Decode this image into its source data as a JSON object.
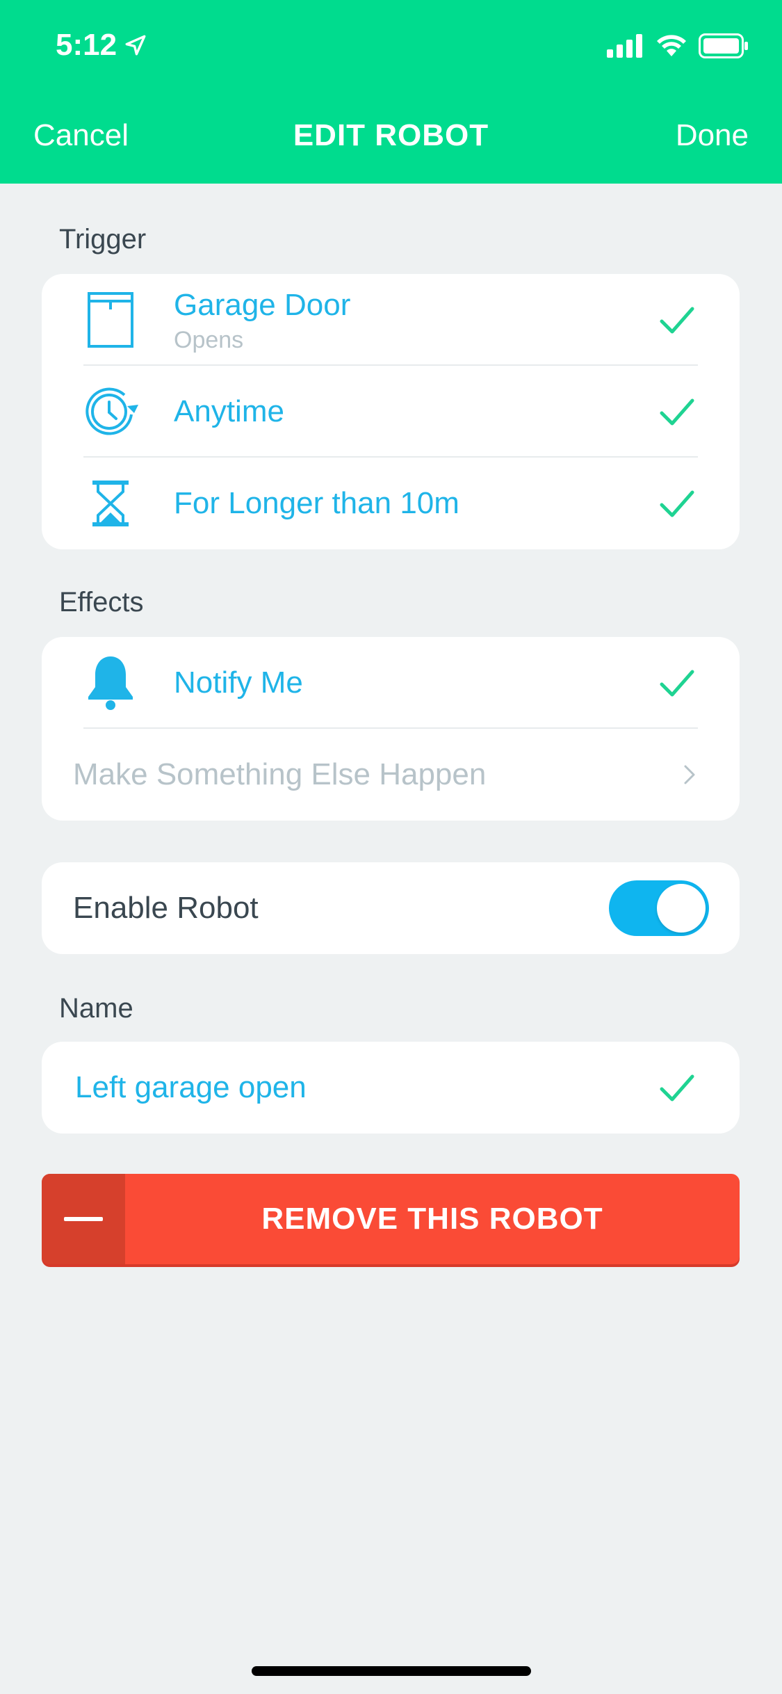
{
  "status_bar": {
    "time": "5:12"
  },
  "nav": {
    "cancel_label": "Cancel",
    "title": "EDIT ROBOT",
    "done_label": "Done"
  },
  "trigger": {
    "section_label": "Trigger",
    "items": [
      {
        "label": "Garage Door",
        "sublabel": "Opens",
        "icon": "garage-door-icon",
        "checked": true
      },
      {
        "label": "Anytime",
        "icon": "clock-icon",
        "checked": true
      },
      {
        "label": "For Longer than 10m",
        "icon": "hourglass-icon",
        "checked": true
      }
    ]
  },
  "effects": {
    "section_label": "Effects",
    "items": [
      {
        "label": "Notify Me",
        "icon": "bell-icon",
        "checked": true
      }
    ],
    "add_effect_label": "Make Something Else Happen"
  },
  "enable": {
    "label": "Enable Robot",
    "enabled": true
  },
  "name": {
    "section_label": "Name",
    "value": "Left garage open"
  },
  "remove_button": {
    "label": "REMOVE THIS ROBOT"
  },
  "colors": {
    "header": "#00dc8e",
    "accent_blue": "#1fb4e8",
    "check_green": "#1fd392",
    "remove_red": "#fa4b36",
    "background": "#eef1f2"
  }
}
